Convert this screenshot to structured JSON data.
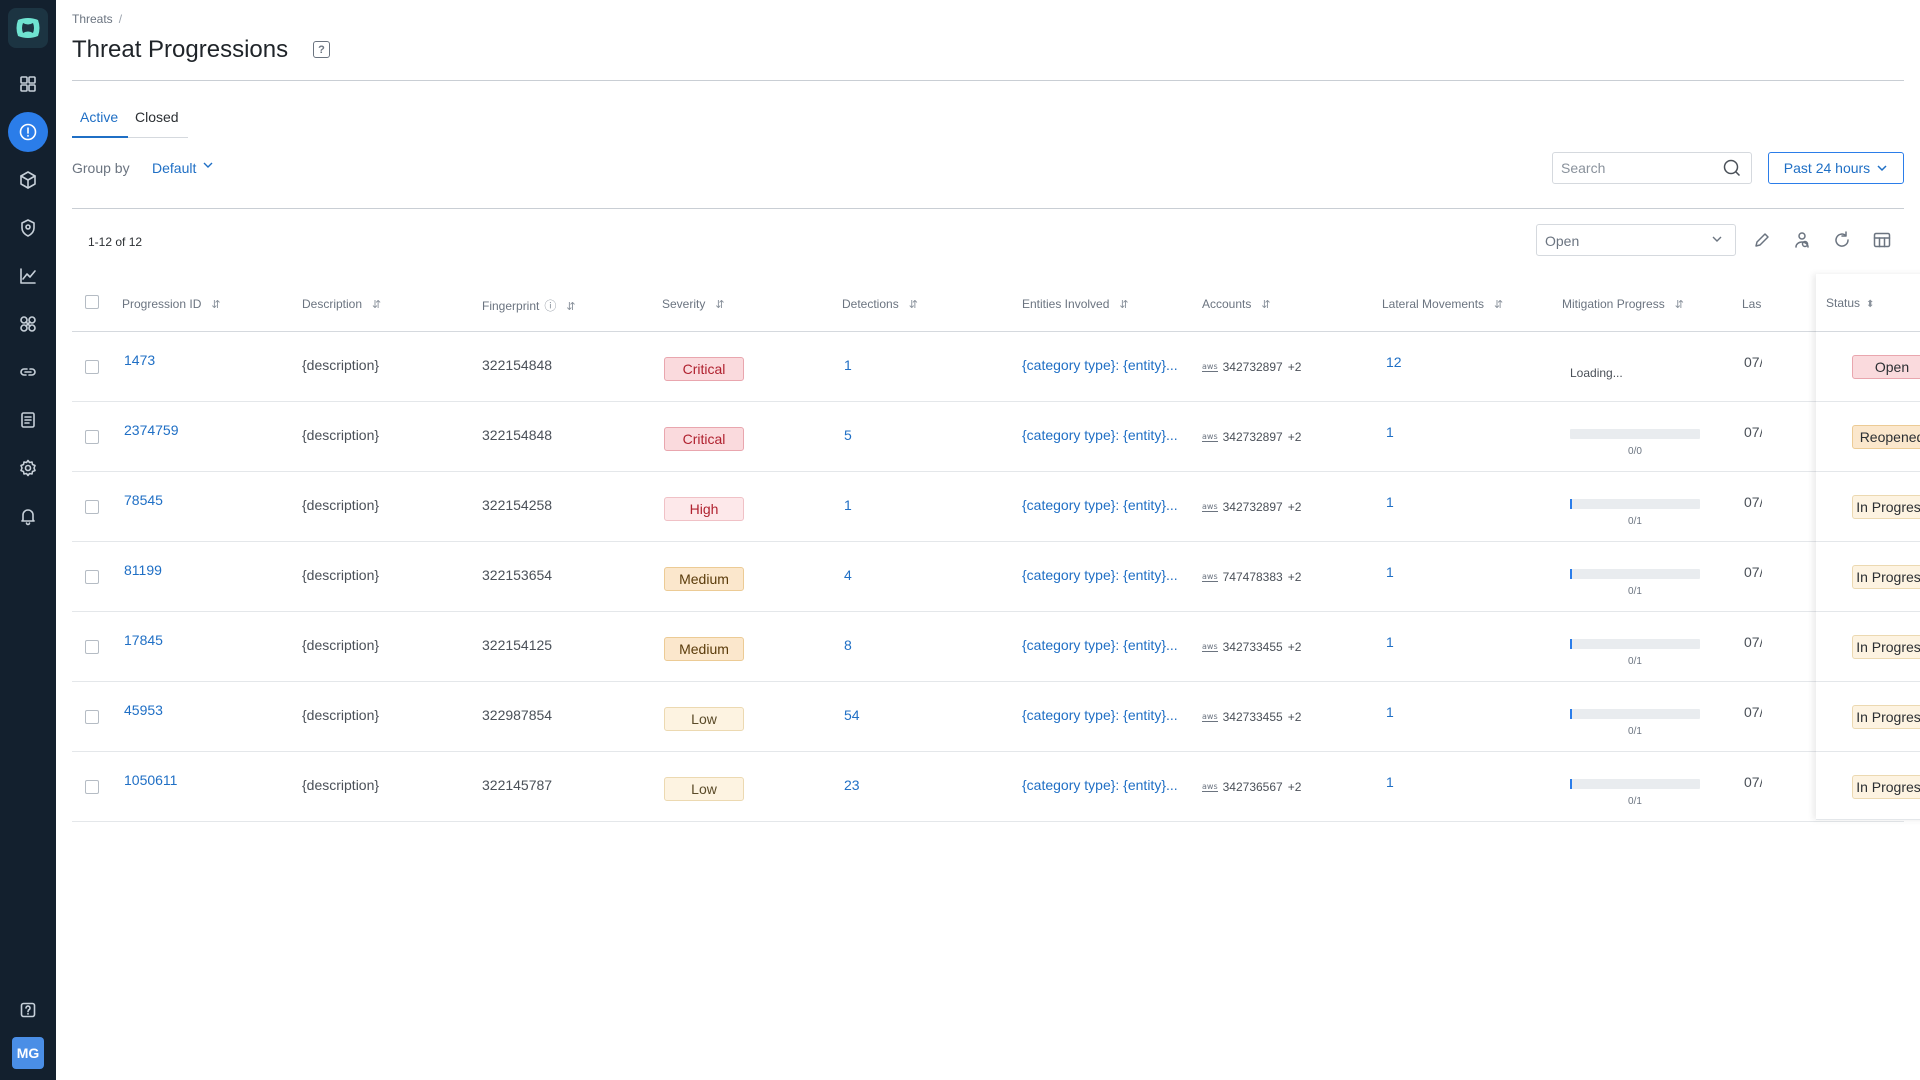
{
  "sidebar": {
    "items": [
      "dashboard",
      "threats",
      "packages",
      "location",
      "analytics",
      "integrations",
      "links",
      "reports",
      "settings",
      "notifications"
    ],
    "help": "help",
    "avatar_initials": "MG"
  },
  "breadcrumb": {
    "root": "Threats",
    "separator": "/"
  },
  "page": {
    "title": "Threat Progressions",
    "help_glyph": "?"
  },
  "tabs": {
    "active": "Active",
    "closed": "Closed"
  },
  "group_by": {
    "label": "Group by",
    "value": "Default"
  },
  "search": {
    "placeholder": "Search"
  },
  "time_filter": {
    "label": "Past 24 hours"
  },
  "pagination": {
    "label": "1-12 of 12"
  },
  "status_filter": {
    "value": "Open"
  },
  "columns": {
    "progression_id": "Progression ID",
    "description": "Description",
    "fingerprint": "Fingerprint",
    "severity": "Severity",
    "detections": "Detections",
    "entities": "Entities Involved",
    "accounts": "Accounts",
    "lateral": "Lateral Movements",
    "mitigation": "Mitigation Progress",
    "last": "Las",
    "status": "Status"
  },
  "rows": [
    {
      "id": "1473",
      "description": "{description}",
      "fingerprint": "322154848",
      "severity": "Critical",
      "detections": "1",
      "entities": "{category type}: {entity}...",
      "account": "342732897",
      "account_extra": "+2",
      "lateral": "12",
      "mitigation_text": "Loading...",
      "last": "07/",
      "status": "Open"
    },
    {
      "id": "2374759",
      "description": "{description}",
      "fingerprint": "322154848",
      "severity": "Critical",
      "detections": "5",
      "entities": "{category type}: {entity}...",
      "account": "342732897",
      "account_extra": "+2",
      "lateral": "1",
      "mitigation_text": "0/0",
      "last": "07/",
      "status": "Reopened"
    },
    {
      "id": "78545",
      "description": "{description}",
      "fingerprint": "322154258",
      "severity": "High",
      "detections": "1",
      "entities": "{category type}: {entity}...",
      "account": "342732897",
      "account_extra": "+2",
      "lateral": "1",
      "mitigation_text": "0/1",
      "last": "07/",
      "status": "In Progress"
    },
    {
      "id": "81199",
      "description": "{description}",
      "fingerprint": "322153654",
      "severity": "Medium",
      "detections": "4",
      "entities": "{category type}: {entity}...",
      "account": "747478383",
      "account_extra": "+2",
      "lateral": "1",
      "mitigation_text": "0/1",
      "last": "07/",
      "status": "In Progress"
    },
    {
      "id": "17845",
      "description": "{description}",
      "fingerprint": "322154125",
      "severity": "Medium",
      "detections": "8",
      "entities": "{category type}: {entity}...",
      "account": "342733455",
      "account_extra": "+2",
      "lateral": "1",
      "mitigation_text": "0/1",
      "last": "07/",
      "status": "In Progress"
    },
    {
      "id": "45953",
      "description": "{description}",
      "fingerprint": "322987854",
      "severity": "Low",
      "detections": "54",
      "entities": "{category type}: {entity}...",
      "account": "342733455",
      "account_extra": "+2",
      "lateral": "1",
      "mitigation_text": "0/1",
      "last": "07/",
      "status": "In Progress"
    },
    {
      "id": "1050611",
      "description": "{description}",
      "fingerprint": "322145787",
      "severity": "Low",
      "detections": "23",
      "entities": "{category type}: {entity}...",
      "account": "342736567",
      "account_extra": "+2",
      "lateral": "1",
      "mitigation_text": "0/1",
      "last": "07/",
      "status": "In Progress"
    }
  ],
  "colors": {
    "sidebar_bg": "#13202e",
    "accent": "#2b7de9",
    "link": "#1f6fc5"
  }
}
